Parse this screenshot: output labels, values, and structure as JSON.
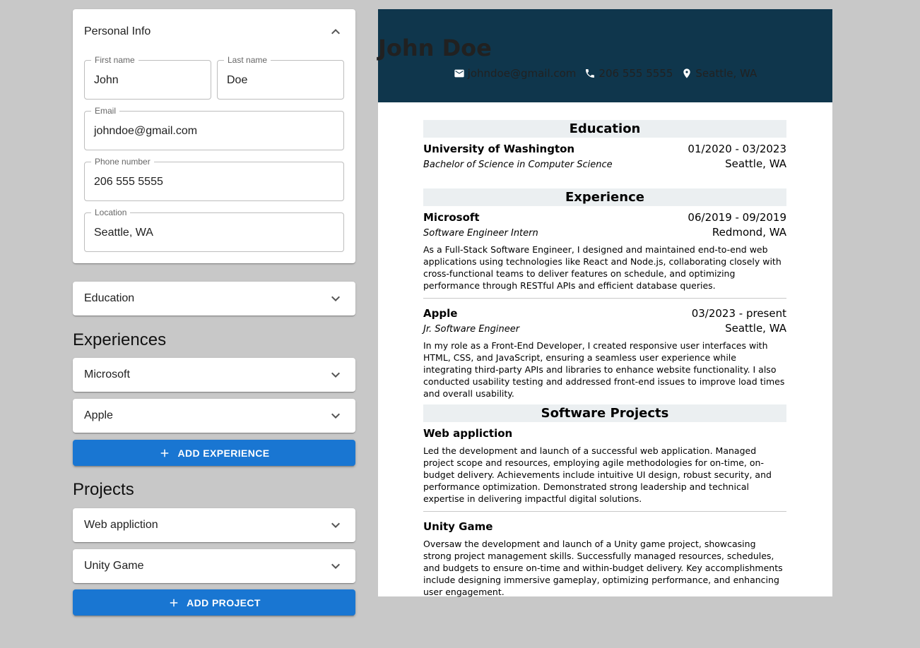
{
  "personal": {
    "title": "Personal Info",
    "first_name_label": "First name",
    "first_name_value": "John",
    "last_name_label": "Last name",
    "last_name_value": "Doe",
    "email_label": "Email",
    "email_value": "johndoe@gmail.com",
    "phone_label": "Phone number",
    "phone_value": "206 555 5555",
    "location_label": "Location",
    "location_value": "Seattle, WA"
  },
  "education": {
    "title": "Education"
  },
  "experiences": {
    "heading": "Experiences",
    "items": [
      {
        "label": "Microsoft"
      },
      {
        "label": "Apple"
      }
    ],
    "add_label": "ADD EXPERIENCE"
  },
  "projects": {
    "heading": "Projects",
    "items": [
      {
        "label": "Web appliction"
      },
      {
        "label": "Unity Game"
      }
    ],
    "add_label": "ADD PROJECT"
  },
  "resume": {
    "name": "John Doe",
    "email": "johndoe@gmail.com",
    "phone": "206 555 5555",
    "location": "Seattle, WA",
    "education_title": "Education",
    "education": [
      {
        "school": "University of Washington",
        "dates": "01/2020 - 03/2023",
        "degree": "Bachelor of Science in Computer Science",
        "location": "Seattle, WA"
      }
    ],
    "experience_title": "Experience",
    "experience": [
      {
        "company": "Microsoft",
        "dates": "06/2019 - 09/2019",
        "role": "Software Engineer Intern",
        "location": "Redmond, WA",
        "description": "As a Full-Stack Software Engineer, I designed and maintained end-to-end web applications using technologies like React and Node.js, collaborating closely with cross-functional teams to deliver features on schedule, and optimizing performance through RESTful APIs and efficient database queries."
      },
      {
        "company": "Apple",
        "dates": "03/2023 - present",
        "role": "Jr. Software Engineer",
        "location": "Seattle, WA",
        "description": "In my role as a Front-End Developer, I created responsive user interfaces with HTML, CSS, and JavaScript, ensuring a seamless user experience while integrating third-party APIs and libraries to enhance website functionality. I also conducted usability testing and addressed front-end issues to improve load times and overall usability."
      }
    ],
    "projects_title": "Software Projects",
    "projects": [
      {
        "name": "Web appliction",
        "description": "Led the development and launch of a successful web application. Managed project scope and resources, employing agile methodologies for on-time, on-budget delivery. Achievements include intuitive UI design, robust security, and performance optimization. Demonstrated strong leadership and technical expertise in delivering impactful digital solutions."
      },
      {
        "name": "Unity Game",
        "description": "Oversaw the development and launch of a Unity game project, showcasing strong project management skills. Successfully managed resources, schedules, and budgets to ensure on-time and within-budget delivery. Key accomplishments include designing immersive gameplay, optimizing performance, and enhancing user engagement."
      }
    ]
  },
  "colors": {
    "accent": "#1976d2",
    "resume_header": "#0f364c",
    "section_band": "#ebeff1",
    "background": "#c8c8c8"
  },
  "icons": [
    "chevron-up-icon",
    "chevron-down-icon",
    "plus-icon",
    "email-icon",
    "phone-icon",
    "location-pin-icon"
  ]
}
